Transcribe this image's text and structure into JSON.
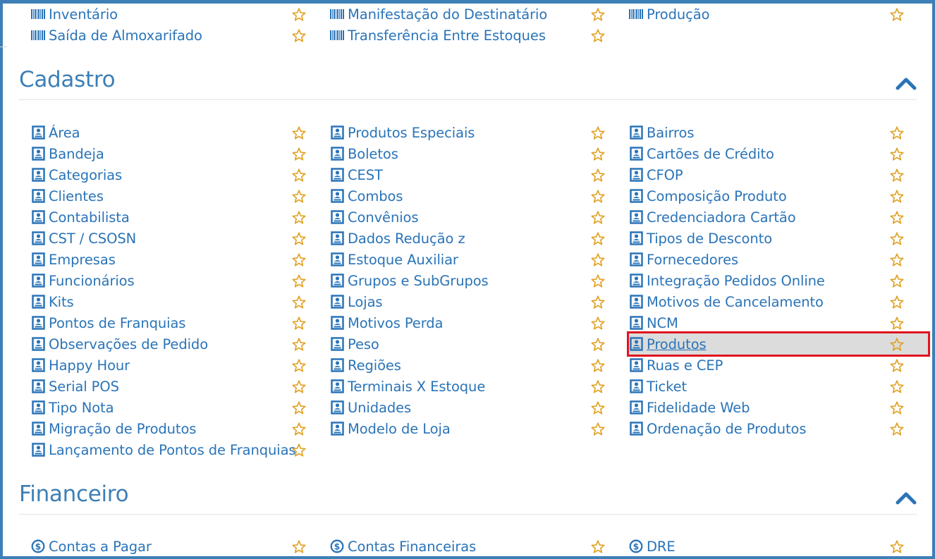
{
  "sections": [
    {
      "id": "estoque",
      "rows": [
        [
          {
            "label": "Inventário",
            "icon": "barcode-icon"
          },
          {
            "label": "Manifestação do Destinatário",
            "icon": "barcode-icon"
          },
          {
            "label": "Produção",
            "icon": "barcode-icon"
          }
        ],
        [
          {
            "label": "Saída de Almoxarifado",
            "icon": "barcode-icon"
          },
          {
            "label": "Transferência Entre Estoques",
            "icon": "barcode-icon"
          }
        ]
      ]
    },
    {
      "id": "cadastro",
      "title": "Cadastro",
      "rows": [
        [
          {
            "label": "Área"
          },
          {
            "label": "Produtos Especiais"
          },
          {
            "label": "Bairros"
          }
        ],
        [
          {
            "label": "Bandeja"
          },
          {
            "label": "Boletos"
          },
          {
            "label": "Cartões de Crédito"
          }
        ],
        [
          {
            "label": "Categorias"
          },
          {
            "label": "CEST"
          },
          {
            "label": "CFOP"
          }
        ],
        [
          {
            "label": "Clientes"
          },
          {
            "label": "Combos"
          },
          {
            "label": "Composição Produto"
          }
        ],
        [
          {
            "label": "Contabilista"
          },
          {
            "label": "Convênios"
          },
          {
            "label": "Credenciadora Cartão"
          }
        ],
        [
          {
            "label": "CST / CSOSN"
          },
          {
            "label": "Dados Redução z"
          },
          {
            "label": "Tipos de Desconto"
          }
        ],
        [
          {
            "label": "Empresas"
          },
          {
            "label": "Estoque Auxiliar"
          },
          {
            "label": "Fornecedores"
          }
        ],
        [
          {
            "label": "Funcionários"
          },
          {
            "label": "Grupos e SubGrupos"
          },
          {
            "label": "Integração Pedidos Online"
          }
        ],
        [
          {
            "label": "Kits"
          },
          {
            "label": "Lojas"
          },
          {
            "label": "Motivos de Cancelamento"
          }
        ],
        [
          {
            "label": "Pontos de Franquias"
          },
          {
            "label": "Motivos Perda"
          },
          {
            "label": "NCM"
          }
        ],
        [
          {
            "label": "Observações de Pedido"
          },
          {
            "label": "Peso"
          },
          {
            "label": "Produtos",
            "selected": true
          }
        ],
        [
          {
            "label": "Happy Hour"
          },
          {
            "label": "Regiões"
          },
          {
            "label": "Ruas e CEP"
          }
        ],
        [
          {
            "label": "Serial POS"
          },
          {
            "label": "Terminais X Estoque"
          },
          {
            "label": "Ticket"
          }
        ],
        [
          {
            "label": "Tipo Nota"
          },
          {
            "label": "Unidades"
          },
          {
            "label": "Fidelidade Web"
          }
        ],
        [
          {
            "label": "Migração de Produtos"
          },
          {
            "label": "Modelo de Loja"
          },
          {
            "label": "Ordenação de Produtos"
          }
        ],
        [
          {
            "label": "Lançamento de Pontos de Franquias"
          }
        ]
      ]
    },
    {
      "id": "financeiro",
      "title": "Financeiro",
      "rows": [
        [
          {
            "label": "Contas a Pagar",
            "icon": "dollar-circle-icon"
          },
          {
            "label": "Contas Financeiras",
            "icon": "dollar-circle-icon"
          },
          {
            "label": "DRE",
            "icon": "dollar-circle-icon"
          }
        ]
      ]
    }
  ],
  "colors": {
    "link": "#2a74b8",
    "title": "#3d7fb6",
    "star": "#e0a224",
    "border": "#3d7fb6",
    "highlight": "#e0141e"
  }
}
